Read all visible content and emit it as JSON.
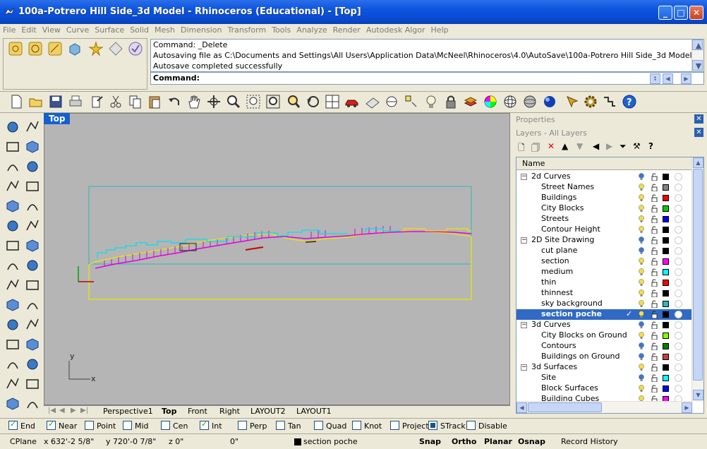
{
  "window": {
    "title": "100a-Potrero Hill Side_3d Model - Rhinoceros (Educational) - [Top]",
    "min_glyph": "_",
    "max_glyph": "□",
    "close_glyph": "✕"
  },
  "menu": [
    "File",
    "Edit",
    "View",
    "Curve",
    "Surface",
    "Solid",
    "Mesh",
    "Dimension",
    "Transform",
    "Tools",
    "Analyze",
    "Render",
    "Autodesk Algor",
    "Help"
  ],
  "command": {
    "history": [
      "Command: _Delete",
      "Autosaving file as C:\\Documents and Settings\\All Users\\Application Data\\McNeel\\Rhinoceros\\4.0\\AutoSave\\100a-Potrero Hill Side_3d Model_",
      "Autosave completed successfully"
    ],
    "prompt": "Command:",
    "value": ""
  },
  "viewport": {
    "label": "Top",
    "axis_x": "x",
    "axis_y": "y"
  },
  "viewport_tabs": {
    "tabs": [
      "Perspective1",
      "Top",
      "Front",
      "Right",
      "LAYOUT2",
      "LAYOUT1"
    ],
    "active": "Top"
  },
  "panels": {
    "properties_title": "Properties",
    "layers_title": "Layers - All Layers",
    "column_name": "Name"
  },
  "layers": [
    {
      "name": "2d Curves",
      "group": true,
      "color": "#000000"
    },
    {
      "name": "Street Names",
      "group": false,
      "color": "#808080"
    },
    {
      "name": "Buildings",
      "group": false,
      "color": "#ff0000"
    },
    {
      "name": "City Blocks",
      "group": false,
      "color": "#00cc00"
    },
    {
      "name": "Streets",
      "group": false,
      "color": "#0000ff"
    },
    {
      "name": "Contour Height",
      "group": false,
      "color": "#000000"
    },
    {
      "name": "2D Site Drawing",
      "group": true,
      "color": "#000000"
    },
    {
      "name": "cut plane",
      "group": false,
      "color": "#000000"
    },
    {
      "name": "section",
      "group": false,
      "color": "#ff00ff"
    },
    {
      "name": "medium",
      "group": false,
      "color": "#00ffff"
    },
    {
      "name": "thin",
      "group": false,
      "color": "#ff0000"
    },
    {
      "name": "thinnest",
      "group": false,
      "color": "#000000"
    },
    {
      "name": "sky background",
      "group": false,
      "color": "#33b5c0"
    },
    {
      "name": "section poche",
      "group": false,
      "color": "#000000",
      "selected": true
    },
    {
      "name": "3d Curves",
      "group": true,
      "color": "#000000"
    },
    {
      "name": "City Blocks on Ground",
      "group": false,
      "color": "#80ff00"
    },
    {
      "name": "Contours",
      "group": false,
      "color": "#008000"
    },
    {
      "name": "Buildings on Ground",
      "group": false,
      "color": "#c04040"
    },
    {
      "name": "3d Surfaces",
      "group": true,
      "color": "#000000"
    },
    {
      "name": "Site",
      "group": false,
      "color": "#00ffff"
    },
    {
      "name": "Block Surfaces",
      "group": false,
      "color": "#0000ff"
    },
    {
      "name": "Building Cubes",
      "group": false,
      "color": "#ff00ff"
    }
  ],
  "osnaps": [
    {
      "label": "End",
      "checked": true
    },
    {
      "label": "Near",
      "checked": true
    },
    {
      "label": "Point",
      "checked": false
    },
    {
      "label": "Mid",
      "checked": false
    },
    {
      "label": "Cen",
      "checked": false
    },
    {
      "label": "Int",
      "checked": true
    },
    {
      "label": "Perp",
      "checked": false
    },
    {
      "label": "Tan",
      "checked": false
    },
    {
      "label": "Quad",
      "checked": false
    },
    {
      "label": "Knot",
      "checked": false
    },
    {
      "label": "Project",
      "checked": false
    },
    {
      "label": "STrack",
      "checked": true
    },
    {
      "label": "Disable",
      "checked": false
    }
  ],
  "status": {
    "cplane": "CPlane",
    "x": "x 632'-2 5/8\"",
    "y": "y 720'-0 7/8\"",
    "z": "z 0\"",
    "dist": "0\"",
    "layer": "section poche",
    "snap": "Snap",
    "ortho": "Ortho",
    "planar": "Planar",
    "osnap": "Osnap",
    "record": "Record History"
  }
}
